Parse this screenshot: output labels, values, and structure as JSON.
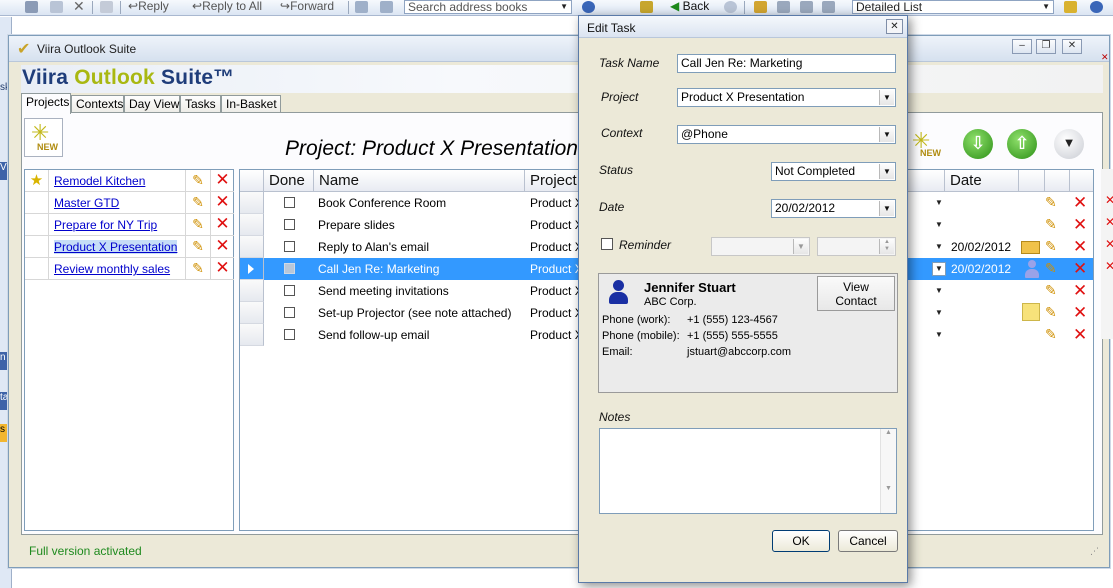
{
  "outlook_toolbar": {
    "reply": "Reply",
    "reply_all": "Reply to All",
    "forward": "Forward",
    "search_placeholder": "Search address books",
    "back": "Back",
    "view": "Detailed List"
  },
  "window": {
    "title": "Viira Outlook Suite",
    "brand_main": "Viira ",
    "brand_accent": "Outlook",
    "brand_tail": " Suite™"
  },
  "tabs": [
    "Projects",
    "Contexts",
    "Day View",
    "Tasks",
    "In-Basket"
  ],
  "new_button_label": "NEW",
  "project_header": "Project: Product X Presentation",
  "projects": [
    {
      "name": "Remodel Kitchen",
      "starred": true,
      "selected": false
    },
    {
      "name": "Master GTD",
      "starred": false,
      "selected": false
    },
    {
      "name": "Prepare for NY Trip",
      "starred": false,
      "selected": false
    },
    {
      "name": "Product X Presentation",
      "starred": false,
      "selected": true
    },
    {
      "name": "Review monthly sales",
      "starred": false,
      "selected": false
    }
  ],
  "grid": {
    "columns": {
      "done": "Done",
      "name": "Name",
      "project": "Project",
      "date": "Date"
    },
    "rows": [
      {
        "name": "Book Conference Room",
        "project": "Product X",
        "date": "",
        "extra": ""
      },
      {
        "name": "Prepare slides",
        "project": "Product X",
        "date": "",
        "extra": ""
      },
      {
        "name": "Reply to Alan's email",
        "project": "Product X",
        "date": "20/02/2012",
        "extra": "envelope-icon"
      },
      {
        "name": "Call Jen Re: Marketing",
        "project": "Product X",
        "date": "20/02/2012",
        "extra": "person-icon",
        "selected": true
      },
      {
        "name": "Send meeting invitations",
        "project": "Product X",
        "date": "",
        "extra": ""
      },
      {
        "name": "Set-up Projector (see note attached)",
        "project": "Product X",
        "date": "",
        "extra": "note-icon"
      },
      {
        "name": "Send follow-up email",
        "project": "Product X",
        "date": "",
        "extra": ""
      }
    ]
  },
  "status": "Full version activated",
  "dialog": {
    "title": "Edit Task",
    "close": "✕",
    "task_name_label": "Task Name",
    "task_name": "Call Jen Re: Marketing",
    "project_label": "Project",
    "project": "Product X Presentation",
    "context_label": "Context",
    "context": "@Phone",
    "status_label": "Status",
    "status": "Not Completed",
    "date_label": "Date",
    "date": "20/02/2012",
    "reminder_label": "Reminder",
    "contact": {
      "name": "Jennifer Stuart",
      "company": "ABC Corp.",
      "view_button_line1": "View",
      "view_button_line2": "Contact",
      "work_label": "Phone (work):",
      "work": "+1 (555) 123-4567",
      "mobile_label": "Phone (mobile):",
      "mobile": "+1 (555) 555-5555",
      "email_label": "Email:",
      "email": "jstuart@abccorp.com"
    },
    "notes_label": "Notes",
    "ok": "OK",
    "cancel": "Cancel"
  }
}
